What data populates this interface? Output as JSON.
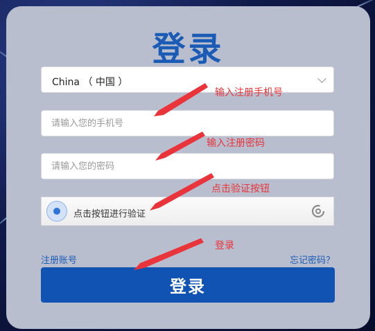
{
  "page": {
    "title": "登录",
    "country_select": {
      "value": "China （ 中国 ）"
    },
    "phone_input": {
      "placeholder": "请输入您的手机号"
    },
    "password_input": {
      "placeholder": "请输入您的密码"
    },
    "captcha": {
      "label": "点击按钮进行验证"
    },
    "register_link": "注册账号",
    "forgot_link": "忘记密码？",
    "login_button": "登录"
  },
  "annotations": [
    {
      "text": "输入注册手机号"
    },
    {
      "text": "输入注册密码"
    },
    {
      "text": "点击验证按钮"
    },
    {
      "text": "登录"
    }
  ],
  "colors": {
    "brand_blue": "#1153b3",
    "title_blue": "#1a5bb5",
    "annotation_red": "#e8343a",
    "card_bg": "#b9bece"
  }
}
